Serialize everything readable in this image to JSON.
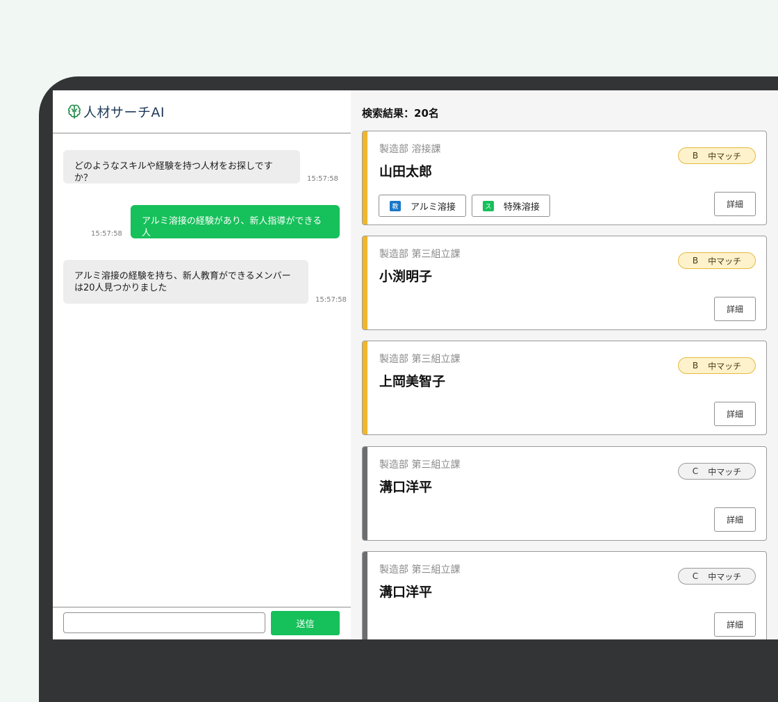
{
  "app": {
    "title": "人材サーチAI"
  },
  "chat": {
    "messages": [
      {
        "role": "bot",
        "text": "どのようなスキルや経験を持つ人材をお探しですか？",
        "time": "15:57:58"
      },
      {
        "role": "user",
        "text": "アルミ溶接の経験があり、新人指導ができる人",
        "time": "15:57:58"
      },
      {
        "role": "bot",
        "text": "アルミ溶接の経験を持ち、新人教育ができるメンバーは20人見つかりました",
        "time": "15:57:58"
      }
    ],
    "input": {
      "value": "",
      "placeholder": ""
    },
    "send_label": "送信"
  },
  "results": {
    "title": "検索結果：20名",
    "cards": [
      {
        "dept": "製造部 溶接課",
        "name": "山田太郎",
        "grade": "B",
        "match": "中マッチ",
        "tags": [
          {
            "icon_text": "教",
            "icon_color": "#1877c9",
            "label": "アルミ溶接"
          },
          {
            "icon_text": "ス",
            "icon_color": "#16c05a",
            "label": "特殊溶接"
          }
        ],
        "detail_label": "詳細"
      },
      {
        "dept": "製造部 第三組立課",
        "name": "小渕明子",
        "grade": "B",
        "match": "中マッチ",
        "tags": [],
        "detail_label": "詳細"
      },
      {
        "dept": "製造部 第三組立課",
        "name": "上岡美智子",
        "grade": "B",
        "match": "中マッチ",
        "tags": [],
        "detail_label": "詳細"
      },
      {
        "dept": "製造部 第三組立課",
        "name": "溝口洋平",
        "grade": "C",
        "match": "中マッチ",
        "tags": [],
        "detail_label": "詳細"
      },
      {
        "dept": "製造部 第三組立課",
        "name": "溝口洋平",
        "grade": "C",
        "match": "中マッチ",
        "tags": [],
        "detail_label": "詳細"
      }
    ]
  },
  "colors": {
    "accent_green": "#16c05a",
    "grade_b_bar": "#f0b62c",
    "grade_c_bar": "#6b6e70",
    "device_frame": "#333435",
    "background": "#f1f8f3"
  },
  "icons": {
    "logo": "brain-icon"
  }
}
